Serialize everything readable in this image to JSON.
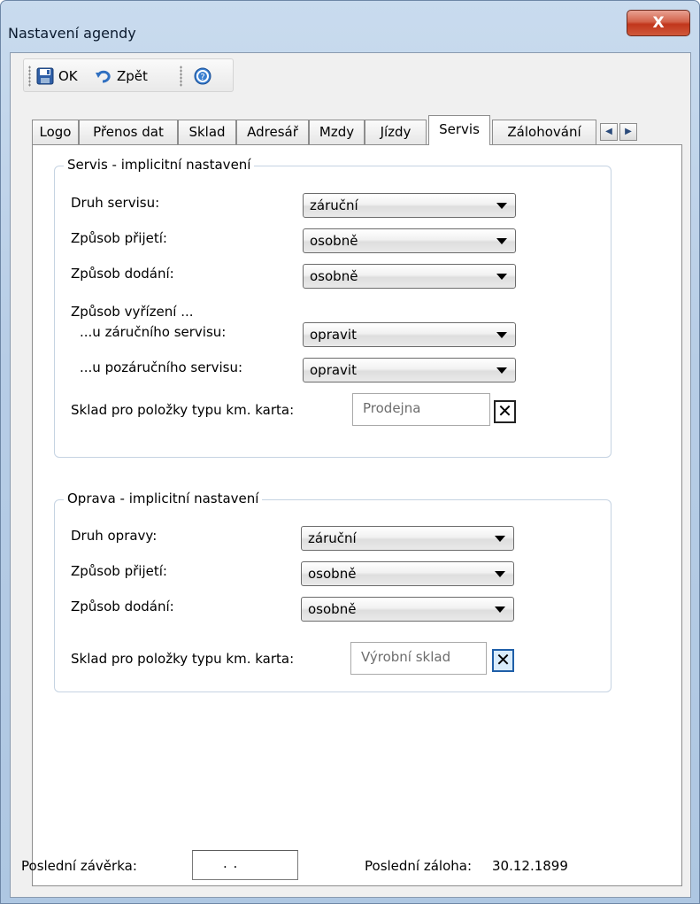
{
  "window": {
    "title": "Nastavení agendy",
    "close_label": "X"
  },
  "toolbar": {
    "ok_label": "OK",
    "back_label": "Zpět",
    "help_icon": "help-icon",
    "save_icon": "save-icon",
    "undo_icon": "undo-icon"
  },
  "tabs": [
    {
      "label": "Logo"
    },
    {
      "label": "Přenos dat"
    },
    {
      "label": "Sklad"
    },
    {
      "label": "Adresář"
    },
    {
      "label": "Mzdy"
    },
    {
      "label": "Jízdy"
    },
    {
      "label": "Servis",
      "active": true
    },
    {
      "label": "Zálohování"
    }
  ],
  "servis": {
    "legend": "Servis - implicitní nastavení",
    "druh_label": "Druh servisu:",
    "druh_value": "záruční",
    "prijeti_label": "Způsob přijetí:",
    "prijeti_value": "osobně",
    "dodani_label": "Způsob dodání:",
    "dodani_value": "osobně",
    "vyrizeni_label": "Způsob vyřízení ...",
    "zarucni_label": "...u záručního servisu:",
    "zarucni_value": "opravit",
    "pozarucni_label": "...u pozáručního servisu:",
    "pozarucni_value": "opravit",
    "sklad_label": "Sklad pro položky typu km. karta:",
    "sklad_value": "Prodejna"
  },
  "oprava": {
    "legend": "Oprava - implicitní nastavení",
    "druh_label": "Druh opravy:",
    "druh_value": "záruční",
    "prijeti_label": "Způsob přijetí:",
    "prijeti_value": "osobně",
    "dodani_label": "Způsob dodání:",
    "dodani_value": "osobně",
    "sklad_label": "Sklad pro položky typu km. karta:",
    "sklad_value": "Výrobní sklad"
  },
  "footer": {
    "zaverka_label": "Poslední závěrka:",
    "zaverka_value": ". .",
    "zaloha_label": "Poslední záloha:",
    "zaloha_value": "30.12.1899"
  }
}
